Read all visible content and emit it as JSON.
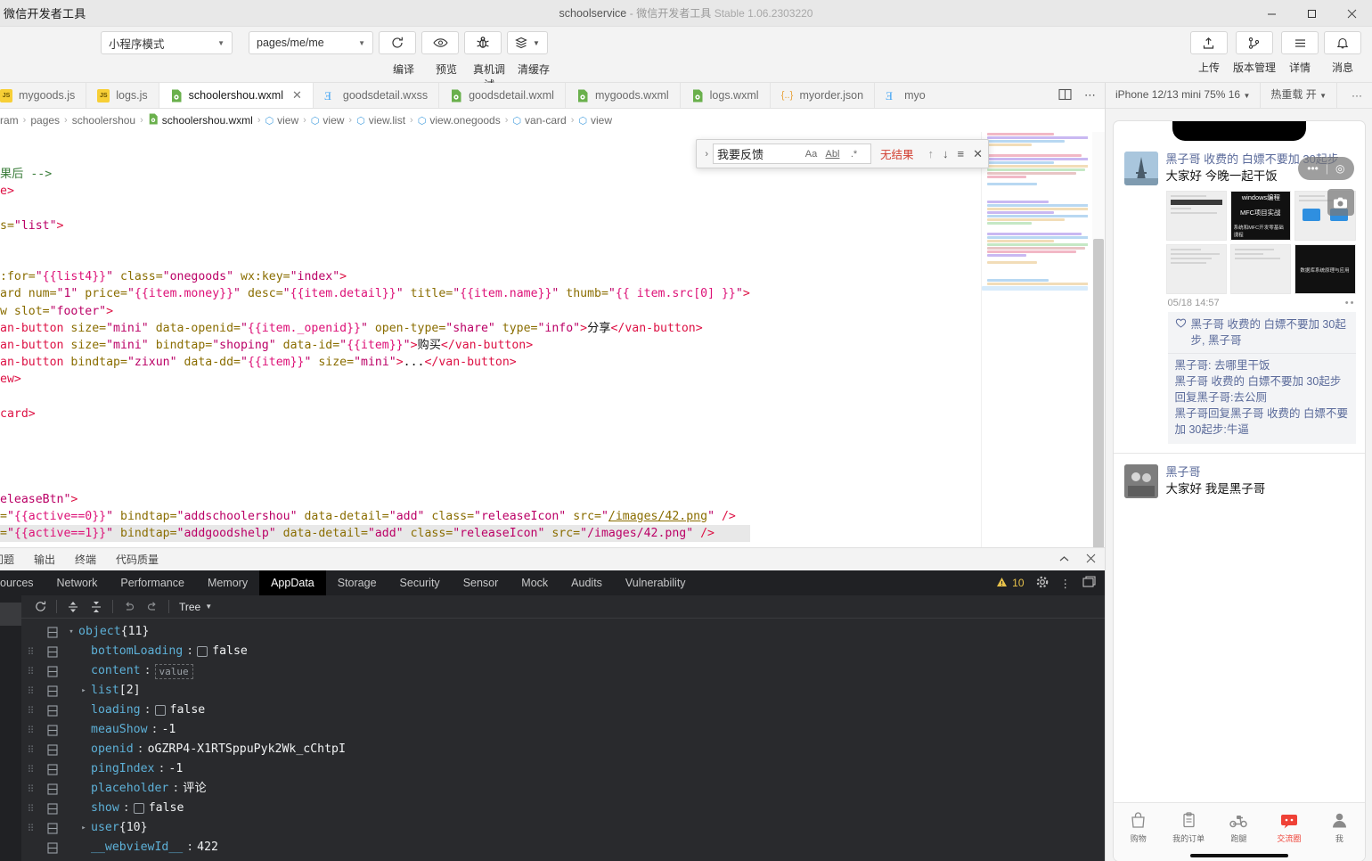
{
  "titlebar": {
    "app_name": "微信开发者工具",
    "project": "schoolservice",
    "dash": "-",
    "product": "微信开发者工具",
    "version": "Stable 1.06.2303220",
    "minimize": "—",
    "maximize": "▢",
    "close": "✕"
  },
  "toolbar": {
    "mode_select": "小程序模式",
    "page_select": "pages/me/me",
    "compile_label": "编译",
    "preview_label": "预览",
    "remote_debug_label": "真机调试",
    "clear_cache_label": "清缓存",
    "upload_label": "上传",
    "version_label": "版本管理",
    "detail_label": "详情",
    "message_label": "消息"
  },
  "tabs": [
    {
      "label": "mygoods.js",
      "type": "js",
      "active": false
    },
    {
      "label": "logs.js",
      "type": "js",
      "active": false
    },
    {
      "label": "schoolershou.wxml",
      "type": "wxml",
      "active": true,
      "close": "✕"
    },
    {
      "label": "goodsdetail.wxss",
      "type": "wxss",
      "active": false
    },
    {
      "label": "goodsdetail.wxml",
      "type": "wxml",
      "active": false
    },
    {
      "label": "mygoods.wxml",
      "type": "wxml",
      "active": false
    },
    {
      "label": "logs.wxml",
      "type": "wxml",
      "active": false
    },
    {
      "label": "myorder.json",
      "type": "json",
      "active": false
    },
    {
      "label": "myo",
      "type": "wxss",
      "active": false
    }
  ],
  "breadcrumb": {
    "items": [
      "ram",
      "pages",
      "schoolershou",
      "schoolershou.wxml",
      "view",
      "view",
      "view.list",
      "view.onegoods",
      "van-card",
      "view"
    ],
    "separator": "›"
  },
  "find": {
    "query": "我要反馈",
    "result": "无结果",
    "match_case": "Aa",
    "whole_word": "Abl",
    "regex": ".*",
    "prev": "↑",
    "next": "↓",
    "selection": "≡",
    "close": "✕",
    "expand": "›"
  },
  "editor": {
    "lines": [
      {
        "id": 1,
        "segments": [
          {
            "t": "果后 ",
            "c": "com"
          },
          {
            "t": "-->",
            "c": "com"
          }
        ]
      },
      {
        "id": 2,
        "segments": [
          {
            "t": "e>",
            "c": "tag"
          }
        ]
      },
      {
        "id": 3,
        "segments": []
      },
      {
        "id": 4,
        "segments": [
          {
            "t": "s=",
            "c": "attr"
          },
          {
            "t": "\"list\"",
            "c": "str"
          },
          {
            "t": ">",
            "c": "tag"
          }
        ]
      },
      {
        "id": 5,
        "segments": []
      },
      {
        "id": 6,
        "segments": []
      },
      {
        "id": 7,
        "segments": [
          {
            "t": ":for=",
            "c": "attr"
          },
          {
            "t": "\"",
            "c": "str"
          },
          {
            "t": "{{list4}}",
            "c": "mus"
          },
          {
            "t": "\"",
            "c": "str"
          },
          {
            "t": " class=",
            "c": "attr"
          },
          {
            "t": "\"onegoods\"",
            "c": "str"
          },
          {
            "t": " wx:key=",
            "c": "attr"
          },
          {
            "t": "\"index\"",
            "c": "str"
          },
          {
            "t": ">",
            "c": "tag"
          }
        ]
      },
      {
        "id": 8,
        "segments": [
          {
            "t": "ard num=",
            "c": "attr"
          },
          {
            "t": "\"1\"",
            "c": "str"
          },
          {
            "t": " price=",
            "c": "attr"
          },
          {
            "t": "\"",
            "c": "str"
          },
          {
            "t": "{{item.money}}",
            "c": "mus"
          },
          {
            "t": "\"",
            "c": "str"
          },
          {
            "t": " desc=",
            "c": "attr"
          },
          {
            "t": "\"",
            "c": "str"
          },
          {
            "t": "{{item.detail}}",
            "c": "mus"
          },
          {
            "t": "\"",
            "c": "str"
          },
          {
            "t": " title=",
            "c": "attr"
          },
          {
            "t": "\"",
            "c": "str"
          },
          {
            "t": "{{item.name}}",
            "c": "mus"
          },
          {
            "t": "\"",
            "c": "str"
          },
          {
            "t": " thumb=",
            "c": "attr"
          },
          {
            "t": "\"",
            "c": "str"
          },
          {
            "t": "{{ item.src[0] }}",
            "c": "mus"
          },
          {
            "t": "\"",
            "c": "str"
          },
          {
            "t": ">",
            "c": "tag"
          }
        ]
      },
      {
        "id": 9,
        "segments": [
          {
            "t": "w slot=",
            "c": "attr"
          },
          {
            "t": "\"footer\"",
            "c": "str"
          },
          {
            "t": ">",
            "c": "tag"
          }
        ]
      },
      {
        "id": 10,
        "segments": [
          {
            "t": "an-button",
            "c": "tag"
          },
          {
            "t": " size=",
            "c": "attr"
          },
          {
            "t": "\"mini\"",
            "c": "str"
          },
          {
            "t": " data-openid=",
            "c": "attr"
          },
          {
            "t": "\"",
            "c": "str"
          },
          {
            "t": "{{item._openid}}",
            "c": "mus"
          },
          {
            "t": "\"",
            "c": "str"
          },
          {
            "t": " open-type=",
            "c": "attr"
          },
          {
            "t": "\"share\"",
            "c": "str"
          },
          {
            "t": " type=",
            "c": "attr"
          },
          {
            "t": "\"info\"",
            "c": "str"
          },
          {
            "t": ">",
            "c": "tag"
          },
          {
            "t": "分享",
            "c": "txt"
          },
          {
            "t": "</van-button>",
            "c": "tag"
          }
        ]
      },
      {
        "id": 11,
        "segments": [
          {
            "t": "an-button",
            "c": "tag"
          },
          {
            "t": " size=",
            "c": "attr"
          },
          {
            "t": "\"mini\"",
            "c": "str"
          },
          {
            "t": " bindtap=",
            "c": "attr"
          },
          {
            "t": "\"shoping\"",
            "c": "str"
          },
          {
            "t": " data-id=",
            "c": "attr"
          },
          {
            "t": "\"",
            "c": "str"
          },
          {
            "t": "{{item}}",
            "c": "mus"
          },
          {
            "t": "\"",
            "c": "str"
          },
          {
            "t": ">",
            "c": "tag"
          },
          {
            "t": "购买",
            "c": "txt"
          },
          {
            "t": "</van-button>",
            "c": "tag"
          }
        ]
      },
      {
        "id": 12,
        "segments": [
          {
            "t": "an-button",
            "c": "tag"
          },
          {
            "t": " bindtap=",
            "c": "attr"
          },
          {
            "t": "\"zixun\"",
            "c": "str"
          },
          {
            "t": " data-dd=",
            "c": "attr"
          },
          {
            "t": "\"",
            "c": "str"
          },
          {
            "t": "{{item}}",
            "c": "mus"
          },
          {
            "t": "\"",
            "c": "str"
          },
          {
            "t": " size=",
            "c": "attr"
          },
          {
            "t": "\"mini\"",
            "c": "str"
          },
          {
            "t": ">",
            "c": "tag"
          },
          {
            "t": "...",
            "c": "txt"
          },
          {
            "t": "</van-button>",
            "c": "tag"
          }
        ]
      },
      {
        "id": 13,
        "segments": [
          {
            "t": "ew>",
            "c": "tag"
          }
        ]
      },
      {
        "id": 14,
        "segments": []
      },
      {
        "id": 15,
        "segments": [
          {
            "t": "card>",
            "c": "tag"
          }
        ]
      },
      {
        "id": 16,
        "segments": []
      },
      {
        "id": 17,
        "segments": []
      },
      {
        "id": 18,
        "segments": []
      },
      {
        "id": 19,
        "segments": []
      },
      {
        "id": 20,
        "segments": [
          {
            "t": "eleaseBtn\"",
            "c": "str"
          },
          {
            "t": ">",
            "c": "tag"
          }
        ]
      },
      {
        "id": 21,
        "segments": [
          {
            "t": "=",
            "c": "attr"
          },
          {
            "t": "\"",
            "c": "str"
          },
          {
            "t": "{{active==0}}",
            "c": "mus"
          },
          {
            "t": "\"",
            "c": "str"
          },
          {
            "t": " bindtap=",
            "c": "attr"
          },
          {
            "t": "\"addschoolershou\"",
            "c": "str"
          },
          {
            "t": " data-detail=",
            "c": "attr"
          },
          {
            "t": "\"add\"",
            "c": "str"
          },
          {
            "t": " class=",
            "c": "attr"
          },
          {
            "t": "\"releaseIcon\"",
            "c": "str"
          },
          {
            "t": " src=",
            "c": "attr"
          },
          {
            "t": "\"",
            "c": "str"
          },
          {
            "t": "/images/42.png",
            "c": "link"
          },
          {
            "t": "\"",
            "c": "str"
          },
          {
            "t": " />",
            "c": "tag"
          }
        ]
      },
      {
        "id": 22,
        "current": true,
        "segments": [
          {
            "t": "=",
            "c": "attr"
          },
          {
            "t": "\"",
            "c": "str"
          },
          {
            "t": "{{active==1}}",
            "c": "mus"
          },
          {
            "t": "\"",
            "c": "str"
          },
          {
            "t": " bindtap=",
            "c": "attr"
          },
          {
            "t": "\"addgoodshelp\"",
            "c": "str"
          },
          {
            "t": " data-detail=",
            "c": "attr"
          },
          {
            "t": "\"add\"",
            "c": "str"
          },
          {
            "t": " class=",
            "c": "attr"
          },
          {
            "t": "\"releaseIcon\"",
            "c": "str"
          },
          {
            "t": " src=",
            "c": "attr"
          },
          {
            "t": "\"/images/42.png\"",
            "c": "str"
          },
          {
            "t": " />",
            "c": "tag"
          }
        ]
      }
    ]
  },
  "devtools": {
    "top_tabs": [
      "问题",
      "输出",
      "终端",
      "代码质量"
    ],
    "panel_tabs": [
      {
        "label": "ources",
        "active": false
      },
      {
        "label": "Network",
        "active": false
      },
      {
        "label": "Performance",
        "active": false
      },
      {
        "label": "Memory",
        "active": false
      },
      {
        "label": "AppData",
        "active": true
      },
      {
        "label": "Storage",
        "active": false
      },
      {
        "label": "Security",
        "active": false
      },
      {
        "label": "Sensor",
        "active": false
      },
      {
        "label": "Mock",
        "active": false
      },
      {
        "label": "Audits",
        "active": false
      },
      {
        "label": "Vulnerability",
        "active": false
      }
    ],
    "warning_count": "10",
    "view_mode": "Tree",
    "tree": [
      {
        "indent": 0,
        "arrow": "▾",
        "key": "object",
        "count": "{11}",
        "dots": false
      },
      {
        "indent": 1,
        "key": "bottomLoading",
        "punct": ":",
        "checkbox": true,
        "value": "false",
        "dots": true
      },
      {
        "indent": 1,
        "key": "content",
        "punct": ":",
        "input": "value",
        "dots": true
      },
      {
        "indent": 1,
        "arrow": "▸",
        "key": "list",
        "count": "[2]",
        "dots": true
      },
      {
        "indent": 1,
        "key": "loading",
        "punct": ":",
        "checkbox": true,
        "value": "false",
        "dots": true
      },
      {
        "indent": 1,
        "key": "meauShow",
        "punct": ":",
        "value": "-1",
        "dots": true
      },
      {
        "indent": 1,
        "key": "openid",
        "punct": ":",
        "value": "oGZRP4-X1RTSppuPyk2Wk_cChtpI",
        "dots": true
      },
      {
        "indent": 1,
        "key": "pingIndex",
        "punct": ":",
        "value": "-1",
        "dots": true
      },
      {
        "indent": 1,
        "key": "placeholder",
        "punct": ":",
        "value": "评论",
        "dots": true
      },
      {
        "indent": 1,
        "key": "show",
        "punct": ":",
        "checkbox": true,
        "value": "false",
        "dots": true
      },
      {
        "indent": 1,
        "arrow": "▸",
        "key": "user",
        "count": "{10}",
        "dots": true
      },
      {
        "indent": 1,
        "key": "__webviewId__",
        "punct": ":",
        "value": "422",
        "dots": false
      }
    ]
  },
  "simulator": {
    "device": "iPhone 12/13 mini 75% 16",
    "hot_reload": "热重载 开",
    "more": "···",
    "post": {
      "author": "黑子哥 收费的 白嫖不要加 30起步",
      "text": "大家好 今晚一起干饭",
      "timestamp": "05/18 14:57",
      "image_texts": [
        "windows编程",
        "MFC项目实战",
        "系统和MFC开发零基础课程"
      ],
      "likes": "黑子哥 收费的 白嫖不要加 30起步, 黑子哥",
      "comments": [
        "黑子哥: 去哪里干饭",
        "黑子哥 收费的 白嫖不要加 30起步回复黑子哥:去公厕",
        "黑子哥回复黑子哥 收费的 白嫖不要加 30起步:牛逼"
      ]
    },
    "post2": {
      "author": "黑子哥",
      "text": "大家好 我是黑子哥"
    },
    "tabbar": [
      {
        "label": "购物",
        "icon": "bag-icon",
        "active": false
      },
      {
        "label": "我的订单",
        "icon": "clipboard-icon",
        "active": false
      },
      {
        "label": "跑腿",
        "icon": "scooter-icon",
        "active": false
      },
      {
        "label": "交流圈",
        "icon": "chat-icon",
        "active": true
      },
      {
        "label": "我",
        "icon": "person-icon",
        "active": false
      }
    ]
  },
  "colors": {
    "accent_red": "#ef4136",
    "warning": "#e8c24a",
    "link_blue": "#5a6a9a"
  }
}
